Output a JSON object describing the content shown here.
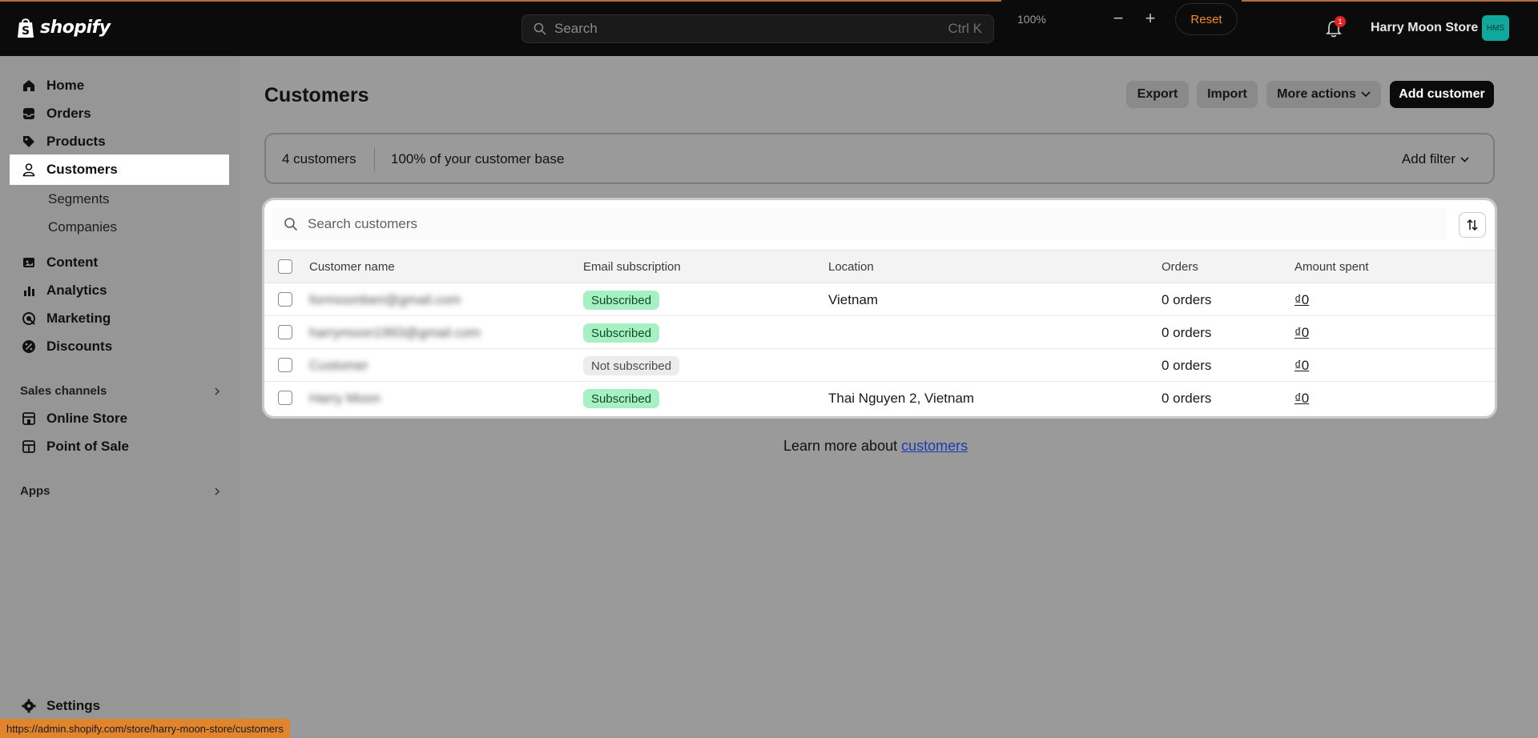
{
  "topbar": {
    "logo_text": "shopify",
    "search_placeholder": "Search",
    "search_shortcut": "Ctrl K",
    "zoom_level": "100%",
    "zoom_minus": "−",
    "zoom_plus": "+",
    "reset_label": "Reset",
    "notification_count": "1",
    "store_name": "Harry Moon Store",
    "avatar_initials": "HMS"
  },
  "sidebar": {
    "items": [
      {
        "label": "Home",
        "icon": "home-icon"
      },
      {
        "label": "Orders",
        "icon": "orders-icon"
      },
      {
        "label": "Products",
        "icon": "tag-icon"
      },
      {
        "label": "Customers",
        "icon": "person-icon",
        "active": true
      },
      {
        "label": "Content",
        "icon": "content-icon"
      },
      {
        "label": "Analytics",
        "icon": "analytics-icon"
      },
      {
        "label": "Marketing",
        "icon": "marketing-icon"
      },
      {
        "label": "Discounts",
        "icon": "discount-icon"
      }
    ],
    "sub_items": [
      "Segments",
      "Companies"
    ],
    "sales_channels_title": "Sales channels",
    "channels": [
      {
        "label": "Online Store",
        "icon": "store-icon"
      },
      {
        "label": "Point of Sale",
        "icon": "pos-icon"
      }
    ],
    "apps_title": "Apps",
    "settings_label": "Settings"
  },
  "main": {
    "title": "Customers",
    "actions": {
      "export": "Export",
      "import": "Import",
      "more_actions": "More actions",
      "add_customer": "Add customer"
    },
    "summary": {
      "count": "4 customers",
      "base": "100% of your customer base",
      "add_filter": "Add filter"
    },
    "table": {
      "search_placeholder": "Search customers",
      "columns": [
        "Customer name",
        "Email subscription",
        "Location",
        "Orders",
        "Amount spent"
      ],
      "rows": [
        {
          "name": "formosmberi@gmail.com",
          "subscription": "Subscribed",
          "location": "Vietnam",
          "orders": "0 orders",
          "amount": "₫0"
        },
        {
          "name": "harrymoon1993@gmail.com",
          "subscription": "Subscribed",
          "location": "",
          "orders": "0 orders",
          "amount": "₫0"
        },
        {
          "name": "Customer",
          "subscription": "Not subscribed",
          "location": "",
          "orders": "0 orders",
          "amount": "₫0"
        },
        {
          "name": "Harry Moon",
          "subscription": "Subscribed",
          "location": "Thai Nguyen 2, Vietnam",
          "orders": "0 orders",
          "amount": "₫0"
        }
      ]
    },
    "learn_prefix": "Learn more about ",
    "learn_link": "customers"
  },
  "status_url": "https://admin.shopify.com/store/harry-moon-store/customers",
  "colors": {
    "topbar_bg": "#0b0b0b",
    "reset_text": "#f08a2e",
    "avatar_bg": "#0fa89a",
    "subscribed_badge": "#a7f0c3",
    "link": "#1b3bb0",
    "status_bar": "#e0842e"
  }
}
